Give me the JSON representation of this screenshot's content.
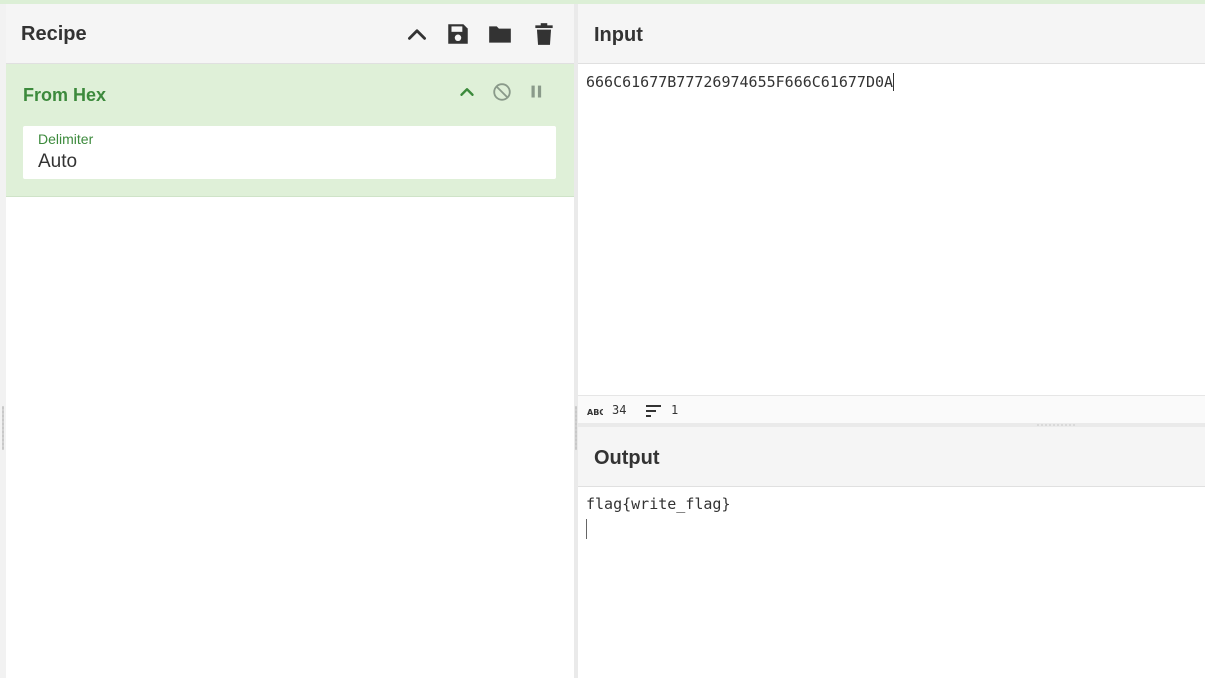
{
  "recipe": {
    "title": "Recipe",
    "icons": [
      "chevron-up-icon",
      "save-icon",
      "folder-icon",
      "trash-icon"
    ]
  },
  "operation": {
    "name": "From Hex",
    "delimiter_label": "Delimiter",
    "delimiter_value": "Auto",
    "icons": [
      "chevron-up-icon",
      "disable-icon",
      "pause-icon"
    ]
  },
  "input": {
    "title": "Input",
    "text": "666C61677B77726974655F666C61677D0A",
    "char_count": "34",
    "line_count": "1"
  },
  "output": {
    "title": "Output",
    "text": "flag{write_flag}"
  },
  "colors": {
    "accent_green": "#3c8a3c",
    "operation_bg": "#dff0d8",
    "header_bg": "#f5f5f5"
  }
}
